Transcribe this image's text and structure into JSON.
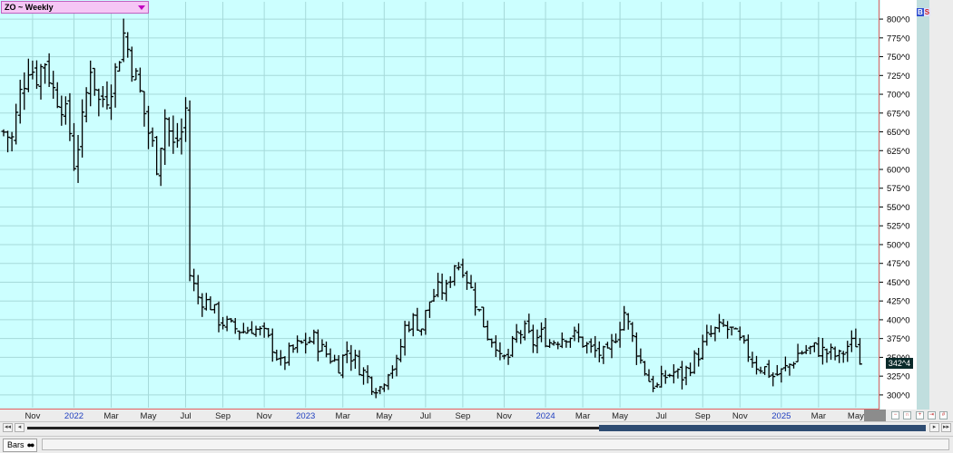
{
  "symbol_title": "ZO ~ Weekly",
  "tab_label": "Bars",
  "bs_buttons": {
    "b": "B",
    "s": "S"
  },
  "last_price_label": "342^4",
  "colors": {
    "plot_bg": "#ccffff",
    "grid": "#a6dada",
    "bar": "#000000",
    "axis_line": "#e06060",
    "year_label": "#2040c0",
    "month_label": "#222222"
  },
  "chart_data": {
    "type": "bar",
    "subtype": "ohlc",
    "title": "ZO ~ Weekly",
    "ylim": [
      283,
      823
    ],
    "y_ticks": [
      300,
      325,
      350,
      375,
      400,
      425,
      450,
      475,
      500,
      525,
      550,
      575,
      600,
      625,
      650,
      675,
      700,
      725,
      750,
      775,
      800
    ],
    "y_tick_labels": [
      "300^0",
      "325^0",
      "350^0",
      "375^0",
      "400^0",
      "425^0",
      "450^0",
      "475^0",
      "500^0",
      "525^0",
      "550^0",
      "575^0",
      "600^0",
      "625^0",
      "650^0",
      "675^0",
      "700^0",
      "725^0",
      "750^0",
      "775^0",
      "800^0"
    ],
    "x_labels": [
      {
        "label": "Nov",
        "week": 7,
        "year": false
      },
      {
        "label": "2022",
        "week": 17,
        "year": true
      },
      {
        "label": "Mar",
        "week": 26,
        "year": false
      },
      {
        "label": "May",
        "week": 35,
        "year": false
      },
      {
        "label": "Jul",
        "week": 44,
        "year": false
      },
      {
        "label": "Sep",
        "week": 53,
        "year": false
      },
      {
        "label": "Nov",
        "week": 63,
        "year": false
      },
      {
        "label": "2023",
        "week": 73,
        "year": true
      },
      {
        "label": "Mar",
        "week": 82,
        "year": false
      },
      {
        "label": "May",
        "week": 92,
        "year": false
      },
      {
        "label": "Jul",
        "week": 102,
        "year": false
      },
      {
        "label": "Sep",
        "week": 111,
        "year": false
      },
      {
        "label": "Nov",
        "week": 121,
        "year": false
      },
      {
        "label": "2024",
        "week": 131,
        "year": true
      },
      {
        "label": "Mar",
        "week": 140,
        "year": false
      },
      {
        "label": "May",
        "week": 149,
        "year": false
      },
      {
        "label": "Jul",
        "week": 159,
        "year": false
      },
      {
        "label": "Sep",
        "week": 169,
        "year": false
      },
      {
        "label": "Nov",
        "week": 178,
        "year": false
      },
      {
        "label": "2025",
        "week": 188,
        "year": true
      },
      {
        "label": "Mar",
        "week": 197,
        "year": false
      },
      {
        "label": "May",
        "week": 206,
        "year": false
      }
    ],
    "last_price": 342.5,
    "waypoints": [
      [
        0,
        650
      ],
      [
        2,
        640
      ],
      [
        4,
        700
      ],
      [
        6,
        740
      ],
      [
        8,
        725
      ],
      [
        10,
        745
      ],
      [
        12,
        705
      ],
      [
        14,
        690
      ],
      [
        16,
        650
      ],
      [
        17,
        610
      ],
      [
        19,
        660
      ],
      [
        21,
        740
      ],
      [
        23,
        690
      ],
      [
        25,
        700
      ],
      [
        27,
        730
      ],
      [
        29,
        780
      ],
      [
        31,
        740
      ],
      [
        33,
        700
      ],
      [
        35,
        650
      ],
      [
        37,
        610
      ],
      [
        39,
        670
      ],
      [
        41,
        630
      ],
      [
        43,
        650
      ],
      [
        44,
        680
      ],
      [
        45,
        460
      ],
      [
        47,
        430
      ],
      [
        50,
        420
      ],
      [
        52,
        400
      ],
      [
        55,
        390
      ],
      [
        58,
        385
      ],
      [
        60,
        390
      ],
      [
        63,
        380
      ],
      [
        65,
        365
      ],
      [
        67,
        340
      ],
      [
        69,
        355
      ],
      [
        71,
        365
      ],
      [
        73,
        370
      ],
      [
        75,
        375
      ],
      [
        77,
        360
      ],
      [
        79,
        350
      ],
      [
        81,
        340
      ],
      [
        83,
        360
      ],
      [
        85,
        345
      ],
      [
        87,
        330
      ],
      [
        89,
        315
      ],
      [
        91,
        310
      ],
      [
        93,
        335
      ],
      [
        95,
        340
      ],
      [
        97,
        390
      ],
      [
        99,
        400
      ],
      [
        101,
        390
      ],
      [
        103,
        425
      ],
      [
        105,
        440
      ],
      [
        107,
        440
      ],
      [
        109,
        475
      ],
      [
        111,
        470
      ],
      [
        113,
        440
      ],
      [
        115,
        410
      ],
      [
        117,
        380
      ],
      [
        119,
        370
      ],
      [
        120,
        345
      ],
      [
        122,
        350
      ],
      [
        124,
        380
      ],
      [
        126,
        385
      ],
      [
        128,
        370
      ],
      [
        130,
        380
      ],
      [
        132,
        370
      ],
      [
        134,
        375
      ],
      [
        136,
        380
      ],
      [
        138,
        378
      ],
      [
        140,
        370
      ],
      [
        142,
        360
      ],
      [
        144,
        355
      ],
      [
        146,
        352
      ],
      [
        148,
        380
      ],
      [
        150,
        410
      ],
      [
        152,
        375
      ],
      [
        154,
        345
      ],
      [
        156,
        320
      ],
      [
        158,
        310
      ],
      [
        160,
        325
      ],
      [
        162,
        330
      ],
      [
        164,
        325
      ],
      [
        166,
        340
      ],
      [
        168,
        355
      ],
      [
        170,
        375
      ],
      [
        172,
        385
      ],
      [
        174,
        390
      ],
      [
        176,
        385
      ],
      [
        178,
        370
      ],
      [
        180,
        355
      ],
      [
        182,
        340
      ],
      [
        184,
        335
      ],
      [
        186,
        325
      ],
      [
        188,
        330
      ],
      [
        190,
        340
      ],
      [
        192,
        355
      ],
      [
        194,
        360
      ],
      [
        196,
        362
      ],
      [
        198,
        358
      ],
      [
        200,
        355
      ],
      [
        202,
        350
      ],
      [
        204,
        365
      ],
      [
        206,
        370
      ],
      [
        207,
        342
      ]
    ],
    "n_weeks": 208
  }
}
